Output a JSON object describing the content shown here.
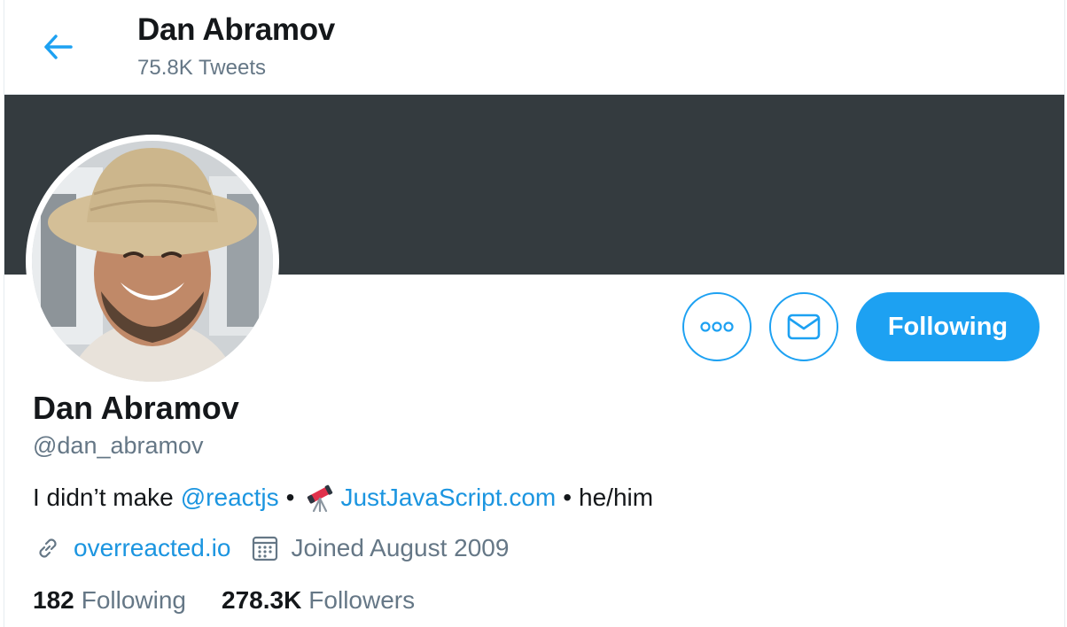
{
  "header": {
    "title": "Dan Abramov",
    "tweet_count": "75.8K Tweets"
  },
  "colors": {
    "accent": "#1da1f2",
    "banner": "#343b3f",
    "muted_text": "#657786",
    "primary_text": "#14171a"
  },
  "actions": {
    "more_icon": "more-dots-icon",
    "message_icon": "envelope-icon",
    "follow_label": "Following"
  },
  "profile": {
    "name": "Dan Abramov",
    "handle": "@dan_abramov",
    "bio": {
      "prefix": "I didn’t make",
      "mention": "@reactjs",
      "sep1": "•",
      "emoji": "telescope-icon",
      "link": "JustJavaScript.com",
      "sep2": "•",
      "suffix": "he/him"
    },
    "website": "overreacted.io",
    "joined": "Joined August 2009"
  },
  "stats": {
    "following_count": "182",
    "following_label": "Following",
    "followers_count": "278.3K",
    "followers_label": "Followers"
  }
}
